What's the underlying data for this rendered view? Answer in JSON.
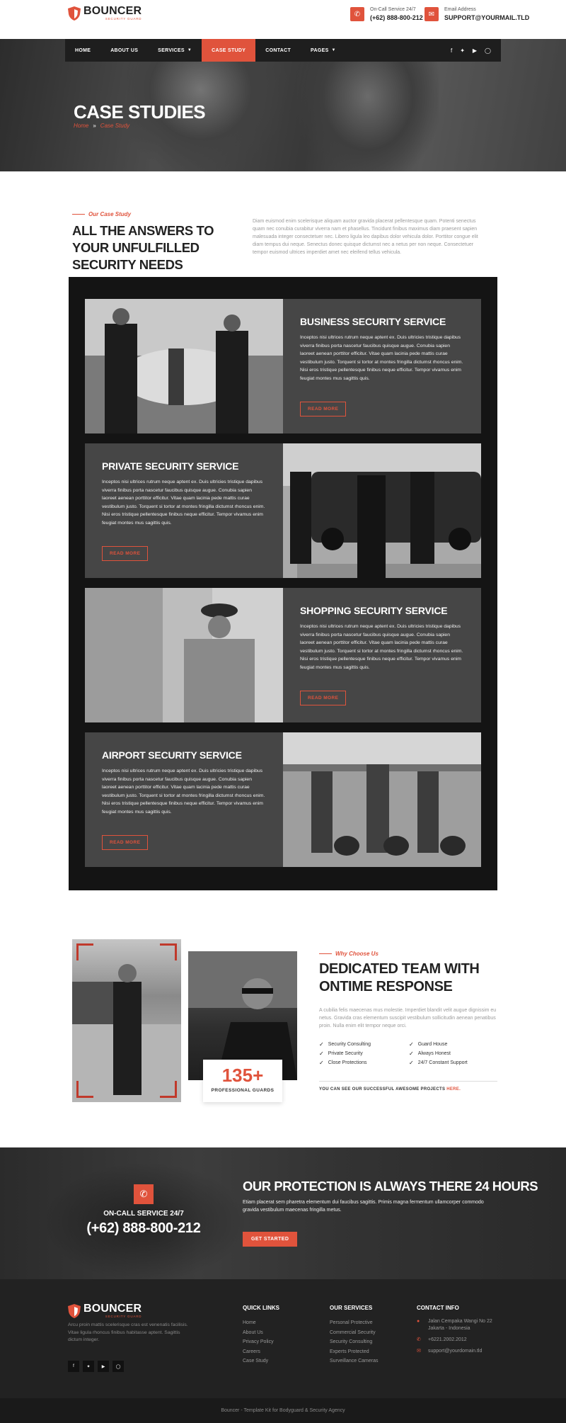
{
  "brand": {
    "name": "BOUNCER",
    "tagline": "SECURITY GUARD",
    "accent": "#e0533c",
    "dark": "#1e1e1e"
  },
  "header": {
    "phone_label": "On-Call Service 24/7",
    "phone": "(+62) 888-800-212",
    "email_label": "Email Address",
    "email": "SUPPORT@YOURMAIL.TLD"
  },
  "nav": {
    "items": [
      {
        "label": "HOME",
        "caret": false
      },
      {
        "label": "ABOUT US",
        "caret": false
      },
      {
        "label": "SERVICES",
        "caret": true
      },
      {
        "label": "CASE STUDY",
        "caret": false,
        "active": true
      },
      {
        "label": "CONTACT",
        "caret": false
      },
      {
        "label": "PAGES",
        "caret": true
      }
    ],
    "social_icons": [
      "facebook-icon",
      "twitter-icon",
      "youtube-icon",
      "instagram-icon"
    ]
  },
  "hero": {
    "title": "CASE STUDIES",
    "breadcrumb_home": "Home",
    "breadcrumb_sep": "»",
    "breadcrumb_current": "Case Study"
  },
  "intro": {
    "kicker": "Our Case Study",
    "title": "ALL THE ANSWERS TO YOUR UNFULFILLED SECURITY NEEDS",
    "text": "Diam euismod enim scelerisque aliquam auctor gravida placerat pellentesque quam. Potenti senectus quam nec conubia curabitur viverra nam et phasellus. Tincidunt finibus maximus diam praesent sapien malesuada integer consectetuer nec. Libero ligula leo dapibus dolor vehicula dolor. Porttitor congue elit diam tempus dui neque. Senectus donec quisque dictumst nec a netus per non neque. Consectetuer tempor euismod ultrices imperdiet amet nec eleifend tellus vehicula."
  },
  "services": [
    {
      "title": "BUSINESS SECURITY SERVICE",
      "text": "Inceptos nisi ultrices rutrum neque aptent ex. Duis ultricies tristique dapibus viverra finibus porta nascetur faucibus quisque augue. Conubia sapien laoreet aenean porttitor efficitur. Vitae quam lacinia pede mattis curae vestibulum justo. Torquent si tortor at montes fringilla dictumst rhoncus enim. Nisi eros tristique pellentesque finibus neque efficitur. Tempor vivamus enim feugiat montes mus sagittis quis.",
      "button": "READ MORE"
    },
    {
      "title": "PRIVATE SECURITY SERVICE",
      "text": "Inceptos nisi ultrices rutrum neque aptent ex. Duis ultricies tristique dapibus viverra finibus porta nascetur faucibus quisque augue. Conubia sapien laoreet aenean porttitor efficitur. Vitae quam lacinia pede mattis curae vestibulum justo. Torquent si tortor at montes fringilla dictumst rhoncus enim. Nisi eros tristique pellentesque finibus neque efficitur. Tempor vivamus enim feugiat montes mus sagittis quis.",
      "button": "READ MORE"
    },
    {
      "title": "SHOPPING SECURITY SERVICE",
      "text": "Inceptos nisi ultrices rutrum neque aptent ex. Duis ultricies tristique dapibus viverra finibus porta nascetur faucibus quisque augue. Conubia sapien laoreet aenean porttitor efficitur. Vitae quam lacinia pede mattis curae vestibulum justo. Torquent si tortor at montes fringilla dictumst rhoncus enim. Nisi eros tristique pellentesque finibus neque efficitur. Tempor vivamus enim feugiat montes mus sagittis quis.",
      "button": "READ MORE"
    },
    {
      "title": "AIRPORT SECURITY SERVICE",
      "text": "Inceptos nisi ultrices rutrum neque aptent ex. Duis ultricies tristique dapibus viverra finibus porta nascetur faucibus quisque augue. Conubia sapien laoreet aenean porttitor efficitur. Vitae quam lacinia pede mattis curae vestibulum justo. Torquent si tortor at montes fringilla dictumst rhoncus enim. Nisi eros tristique pellentesque finibus neque efficitur. Tempor vivamus enim feugiat montes mus sagittis quis.",
      "button": "READ MORE"
    }
  ],
  "why": {
    "kicker": "Why Choose Us",
    "title": "DEDICATED TEAM WITH ONTIME RESPONSE",
    "text": "A cubilia felis maecenas mus molestie. Imperdiet blandit velit augue dignissim eu netus. Gravida cras elementum suscipit vestibulum sollicitudin aenean penatibus proin. Nulla enim elit tempor neque orci.",
    "stat_number": "135+",
    "stat_label": "PROFESSIONAL GUARDS",
    "features": [
      "Security Consulting",
      "Guard House",
      "Private Security",
      "Always Honest",
      "Close Protections",
      "24/7 Constant Support"
    ],
    "footer_text": "YOU CAN SEE OUR SUCCESSFUL AWESOME PROJECTS",
    "footer_link": "HERE."
  },
  "cta": {
    "label": "ON-CALL SERVICE 24/7",
    "phone": "(+62) 888-800-212",
    "title": "OUR PROTECTION IS ALWAYS THERE 24 HOURS",
    "text": "Etiam placerat sem pharetra elementum dui faucibus sagittis. Primis magna fermentum ullamcorper commodo gravida vestibulum maecenas fringilla metus.",
    "button": "GET STARTED"
  },
  "footer": {
    "description": "Arcu proin mattis scelerisque cras est venenatis facilisis. Vitae ligula rhoncus finibus habitasse aptent. Sagittis dictum integer.",
    "quick_links_title": "QUICK LINKS",
    "quick_links": [
      "Home",
      "About Us",
      "Privacy Policy",
      "Careers",
      "Case Study"
    ],
    "services_title": "OUR SERVICES",
    "services": [
      "Personal Protective",
      "Commercial Security",
      "Security Consulting",
      "Experts Protected",
      "Surveillance Cameras"
    ],
    "contact_title": "CONTACT INFO",
    "address_1": "Jalan Cempaka Wangi No 22",
    "address_2": "Jakarta - Indonesia",
    "phone": "+6221.2002.2012",
    "email": "support@yourdomain.tld",
    "copyright": "Bouncer - Template Kit for Bodyguard & Security Agency"
  }
}
